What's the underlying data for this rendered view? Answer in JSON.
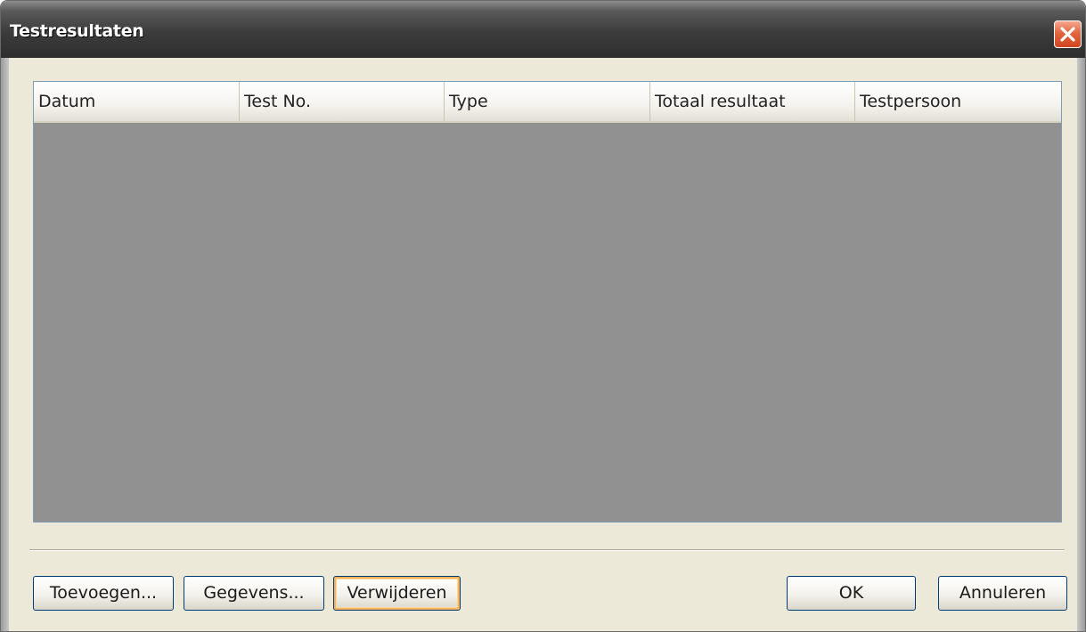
{
  "window": {
    "title": "Testresultaten",
    "close_icon": "close-icon"
  },
  "table": {
    "columns": [
      "Datum",
      "Test No.",
      "Type",
      "Totaal resultaat",
      "Testpersoon"
    ],
    "rows": []
  },
  "buttons": {
    "add": "Toevoegen...",
    "details": "Gegevens...",
    "delete": "Verwijderen",
    "ok": "OK",
    "cancel": "Annuleren"
  },
  "colors": {
    "close_button": "#e2663f",
    "list_background": "#919191",
    "dialog_background": "#ece9d8",
    "focus_highlight": "#f8b35a"
  }
}
